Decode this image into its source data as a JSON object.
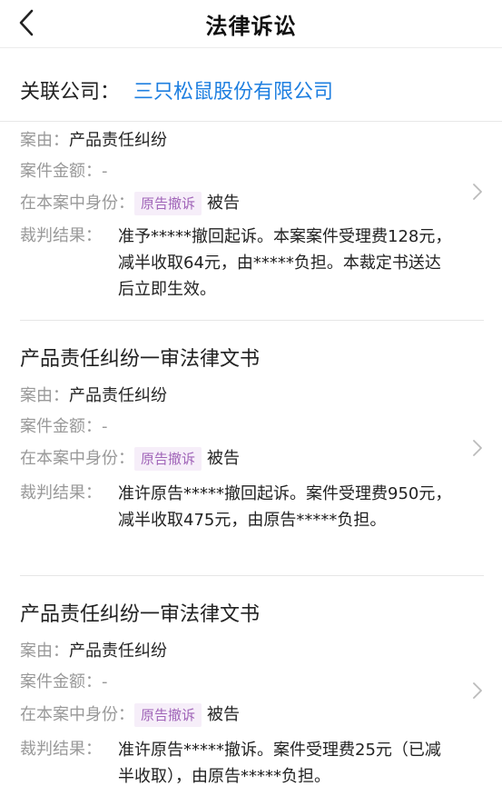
{
  "header": {
    "title": "法律诉讼"
  },
  "company": {
    "label": "关联公司：",
    "name": "三只松鼠股份有限公司"
  },
  "labels": {
    "cause": "案由：",
    "amount": "案件金额：",
    "role": "在本案中身份：",
    "result": "裁判结果："
  },
  "cases": [
    {
      "title": "",
      "cause": "产品责任纠纷",
      "amount": "-",
      "role_badge": "原告撤诉",
      "role": "被告",
      "result": "准予*****撤回起诉。本案案件受理费128元，减半收取64元，由*****负担。本裁定书送达后立即生效。"
    },
    {
      "title": "产品责任纠纷一审法律文书",
      "cause": "产品责任纠纷",
      "amount": "-",
      "role_badge": "原告撤诉",
      "role": "被告",
      "result": "准许原告*****撤回起诉。案件受理费950元，减半收取475元，由原告*****负担。"
    },
    {
      "title": "产品责任纠纷一审法律文书",
      "cause": "产品责任纠纷",
      "amount": "-",
      "role_badge": "原告撤诉",
      "role": "被告",
      "result": "准许原告*****撤诉。案件受理费25元（已减半收取），由原告*****负担。"
    }
  ]
}
